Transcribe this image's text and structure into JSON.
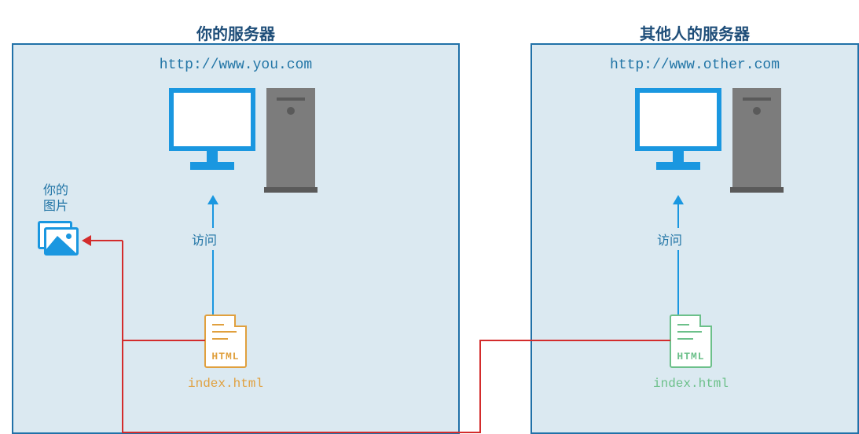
{
  "left_box": {
    "title": "你的服务器",
    "url": "http://www.you.com",
    "access_label": "访问",
    "file_label": "index.html",
    "file_badge": "HTML"
  },
  "right_box": {
    "title": "其他人的服务器",
    "url": "http://www.other.com",
    "access_label": "访问",
    "file_label": "index.html",
    "file_badge": "HTML"
  },
  "image": {
    "label": "你的\n图片"
  }
}
